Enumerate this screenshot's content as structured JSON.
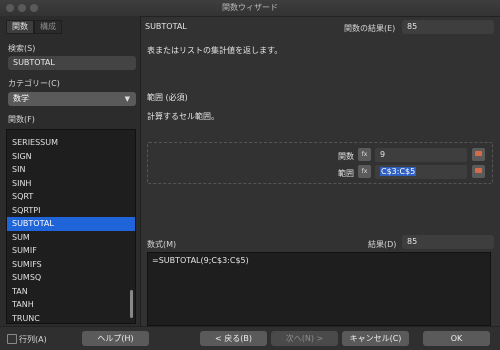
{
  "window": {
    "title": "関数ウィザード"
  },
  "left": {
    "tabs": [
      "関数",
      "構成"
    ],
    "search_label": "検索(S)",
    "search_value": "SUBTOTAL",
    "category_label": "カテゴリー(C)",
    "category_value": "数学",
    "functions_label": "関数(F)",
    "functions": [
      "SERIESSUM",
      "SIGN",
      "SIN",
      "SINH",
      "SQRT",
      "SQRTPI",
      "SUBTOTAL",
      "SUM",
      "SUMIF",
      "SUMIFS",
      "SUMSQ",
      "TAN",
      "TANH",
      "TRUNC"
    ],
    "selected_function": "SUBTOTAL"
  },
  "right": {
    "function_name": "SUBTOTAL",
    "result_label": "関数の結果(E)",
    "result_value": "85",
    "description": "表またはリストの集計値を返します。",
    "param_title": "範囲 (必須)",
    "param_desc": "計算するセル範囲。",
    "args": [
      {
        "label": "関数",
        "value": "9"
      },
      {
        "label": "範囲",
        "value": "C$3:C$5"
      }
    ],
    "formula_label": "数式(M)",
    "formula_result_label": "結果(D)",
    "formula_result_value": "85",
    "formula": "=SUBTOTAL(9;C$3:C$5)"
  },
  "footer": {
    "array_label": "行列(A)",
    "help": "ヘルプ(H)",
    "back": "< 戻る(B)",
    "next": "次へ(N) >",
    "cancel": "キャンセル(C)",
    "ok": "OK"
  }
}
